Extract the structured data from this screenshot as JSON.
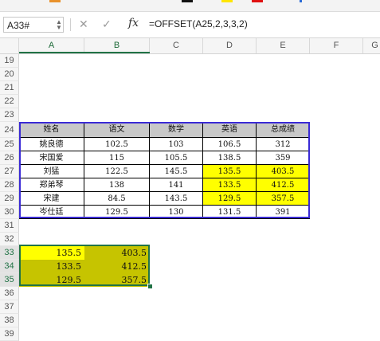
{
  "name_box": "A33#",
  "formula": "=OFFSET(A25,2,3,3,2)",
  "columns": [
    "A",
    "B",
    "C",
    "D",
    "E",
    "F",
    "G"
  ],
  "row_numbers": [
    "19",
    "20",
    "21",
    "22",
    "23",
    "24",
    "25",
    "26",
    "27",
    "28",
    "29",
    "30",
    "31",
    "32",
    "33",
    "34",
    "35",
    "36",
    "37",
    "38",
    "39"
  ],
  "table": {
    "headers": [
      "姓名",
      "语文",
      "数学",
      "英语",
      "总成绩"
    ],
    "rows": [
      [
        "姚良德",
        "102.5",
        "103",
        "106.5",
        "312"
      ],
      [
        "宋国爱",
        "115",
        "105.5",
        "138.5",
        "359"
      ],
      [
        "刘猛",
        "122.5",
        "145.5",
        "135.5",
        "403.5"
      ],
      [
        "郑弟琴",
        "138",
        "141",
        "133.5",
        "412.5"
      ],
      [
        "宋建",
        "84.5",
        "143.5",
        "129.5",
        "357.5"
      ],
      [
        "岑仕廷",
        "129.5",
        "130",
        "131.5",
        "391"
      ]
    ]
  },
  "result": [
    [
      "135.5",
      "403.5"
    ],
    [
      "133.5",
      "412.5"
    ],
    [
      "129.5",
      "357.5"
    ]
  ],
  "colors": {
    "header_fill": "#c8c8c8",
    "highlight": "#ffff00",
    "selection_fill": "#c6c400",
    "table_outline": "#3a2ad6",
    "selection_border": "#217346"
  }
}
